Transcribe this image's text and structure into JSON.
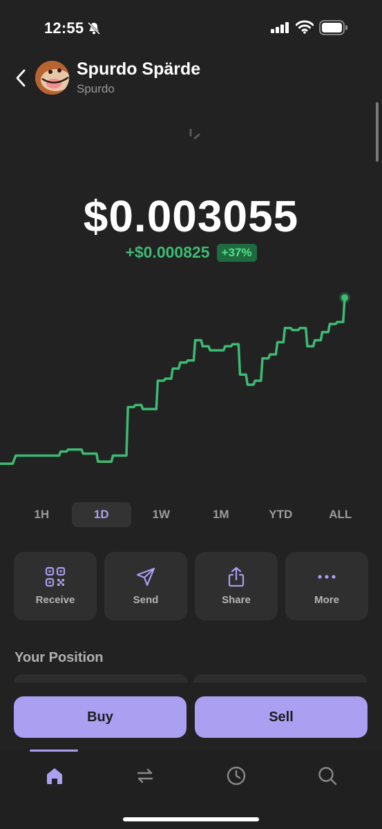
{
  "status_bar": {
    "time": "12:55"
  },
  "header": {
    "name": "Spurdo Spärde",
    "symbol": "Spurdo"
  },
  "price": {
    "value": "$0.003055",
    "change_abs": "+$0.000825",
    "change_pct": "+37%",
    "trend_color": "#3dbb72"
  },
  "chart_data": {
    "type": "line",
    "range": "1D",
    "series": [
      {
        "values": [
          0.00223,
          0.00227,
          0.00227,
          0.00227,
          0.00227,
          0.00227,
          0.00227,
          0.00229,
          0.0023,
          0.0023,
          0.00228,
          0.00228,
          0.00224,
          0.00224,
          0.00227,
          0.00227,
          0.00251,
          0.00252,
          0.0025,
          0.0025,
          0.00264,
          0.00265,
          0.0027,
          0.00273,
          0.00274,
          0.00284,
          0.00281,
          0.00279,
          0.00279,
          0.00281,
          0.00282,
          0.00267,
          0.00262,
          0.00264,
          0.00275,
          0.00277,
          0.00283,
          0.0029,
          0.00289,
          0.0029,
          0.00281,
          0.00284,
          0.00288,
          0.00292,
          0.00293,
          0.00305
        ]
      }
    ]
  },
  "time_ranges": [
    "1H",
    "1D",
    "1W",
    "1M",
    "YTD",
    "ALL"
  ],
  "selected_range": "1D",
  "actions": [
    {
      "label": "Receive",
      "icon": "qr-code-icon"
    },
    {
      "label": "Send",
      "icon": "paper-plane-icon"
    },
    {
      "label": "Share",
      "icon": "share-icon"
    },
    {
      "label": "More",
      "icon": "ellipsis-icon"
    }
  ],
  "position": {
    "title": "Your Position"
  },
  "trade": {
    "buy": "Buy",
    "sell": "Sell"
  },
  "tabs": [
    {
      "name": "home",
      "icon": "home-icon",
      "active": true
    },
    {
      "name": "swap",
      "icon": "swap-arrows-icon",
      "active": false
    },
    {
      "name": "activity",
      "icon": "clock-icon",
      "active": false
    },
    {
      "name": "search",
      "icon": "search-icon",
      "active": false
    }
  ],
  "colors": {
    "accent": "#ab9ff2",
    "background": "#222222",
    "positive": "#3dbb72"
  }
}
